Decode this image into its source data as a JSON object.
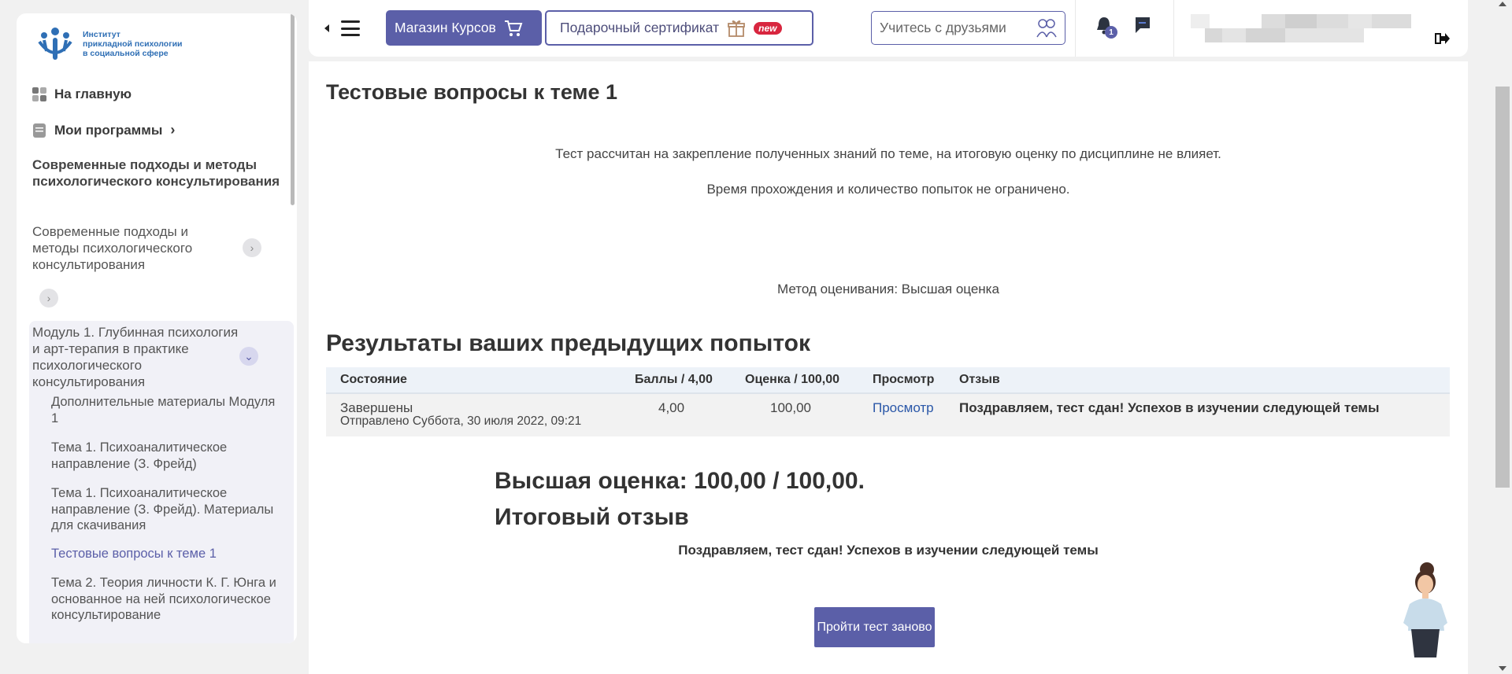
{
  "sidebar": {
    "logo": {
      "line1": "Институт",
      "line2": "прикладной психологии",
      "line3": "в социальной сфере"
    },
    "home": "На главную",
    "programs": "Мои программы",
    "course_title": "Современные подходы и методы психологического консультирования",
    "course_item": "Современные подходы и методы психологического консультирования",
    "module_title": "Модуль 1. Глубинная психология и арт-терапия в практике психологического консультирования",
    "items": [
      "Дополнительные материалы Модуля 1",
      "Тема 1. Психоаналитическое направление (З. Фрейд)",
      "Тема 1. Психоаналитическое направление (З. Фрейд). Материалы для скачивания",
      "Тестовые вопросы к теме 1",
      "Тема 2. Теория личности К. Г. Юнга и основанное на ней психологическое консультирование"
    ],
    "active_index": 3
  },
  "header": {
    "shop_label": "Магазин Курсов",
    "gift_label": "Подарочный сертификат",
    "new_badge": "new",
    "friends_placeholder": "Учитесь с друзьями",
    "notification_count": "1"
  },
  "main": {
    "title": "Тестовые вопросы к теме 1",
    "intro1": "Тест рассчитан на закрепление полученных знаний по теме, на итоговую оценку по дисциплине не влияет.",
    "intro2": "Время прохождения и количество попыток не ограничено.",
    "grading": "Метод оценивания: Высшая оценка",
    "results_title": "Результаты ваших предыдущих попыток",
    "table": {
      "headers": [
        "Состояние",
        "Баллы / 4,00",
        "Оценка / 100,00",
        "Просмотр",
        "Отзыв"
      ],
      "rows": [
        {
          "state": "Завершены",
          "submitted": "Отправлено Суббота, 30 июля 2022, 09:21",
          "score": "4,00",
          "grade": "100,00",
          "review": "Просмотр",
          "feedback": "Поздравляем, тест сдан! Успехов в изучении следующей темы"
        }
      ]
    },
    "highest_grade": "Высшая оценка: 100,00 / 100,00.",
    "final_feedback_title": "Итоговый отзыв",
    "final_feedback_text": "Поздравляем, тест сдан! Успехов в изучении следующей темы",
    "retry_label": "Пройти тест заново"
  },
  "colors": {
    "accent": "#5b5fa8",
    "link": "#2a57a8",
    "badge": "#d8263f"
  }
}
